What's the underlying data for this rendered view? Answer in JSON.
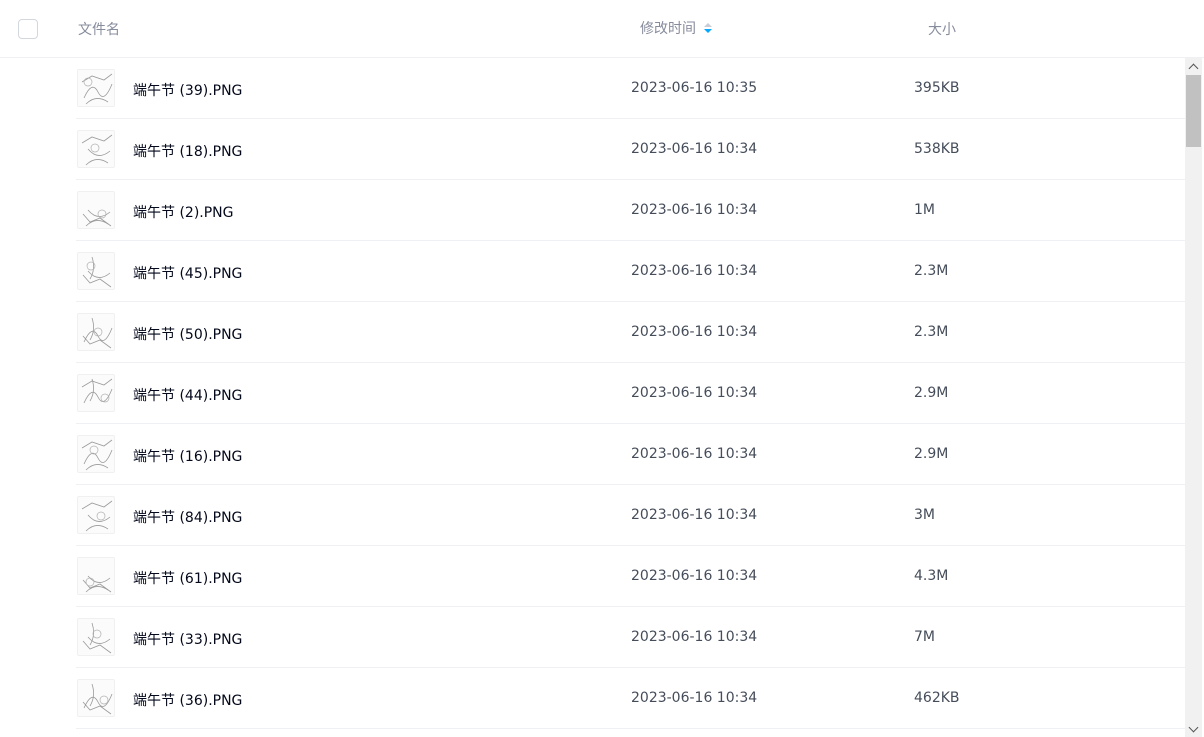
{
  "header": {
    "name_label": "文件名",
    "time_label": "修改时间",
    "size_label": "大小",
    "sort_icon": "sort-desc-icon",
    "accent_color": "#06a7ff"
  },
  "files": [
    {
      "name": "端午节 (39).PNG",
      "time": "2023-06-16 10:35",
      "size": "395KB"
    },
    {
      "name": "端午节 (18).PNG",
      "time": "2023-06-16 10:34",
      "size": "538KB"
    },
    {
      "name": "端午节 (2).PNG",
      "time": "2023-06-16 10:34",
      "size": "1M"
    },
    {
      "name": "端午节 (45).PNG",
      "time": "2023-06-16 10:34",
      "size": "2.3M"
    },
    {
      "name": "端午节 (50).PNG",
      "time": "2023-06-16 10:34",
      "size": "2.3M"
    },
    {
      "name": "端午节 (44).PNG",
      "time": "2023-06-16 10:34",
      "size": "2.9M"
    },
    {
      "name": "端午节 (16).PNG",
      "time": "2023-06-16 10:34",
      "size": "2.9M"
    },
    {
      "name": "端午节 (84).PNG",
      "time": "2023-06-16 10:34",
      "size": "3M"
    },
    {
      "name": "端午节 (61).PNG",
      "time": "2023-06-16 10:34",
      "size": "4.3M"
    },
    {
      "name": "端午节 (33).PNG",
      "time": "2023-06-16 10:34",
      "size": "7M"
    },
    {
      "name": "端午节 (36).PNG",
      "time": "2023-06-16 10:34",
      "size": "462KB"
    }
  ]
}
